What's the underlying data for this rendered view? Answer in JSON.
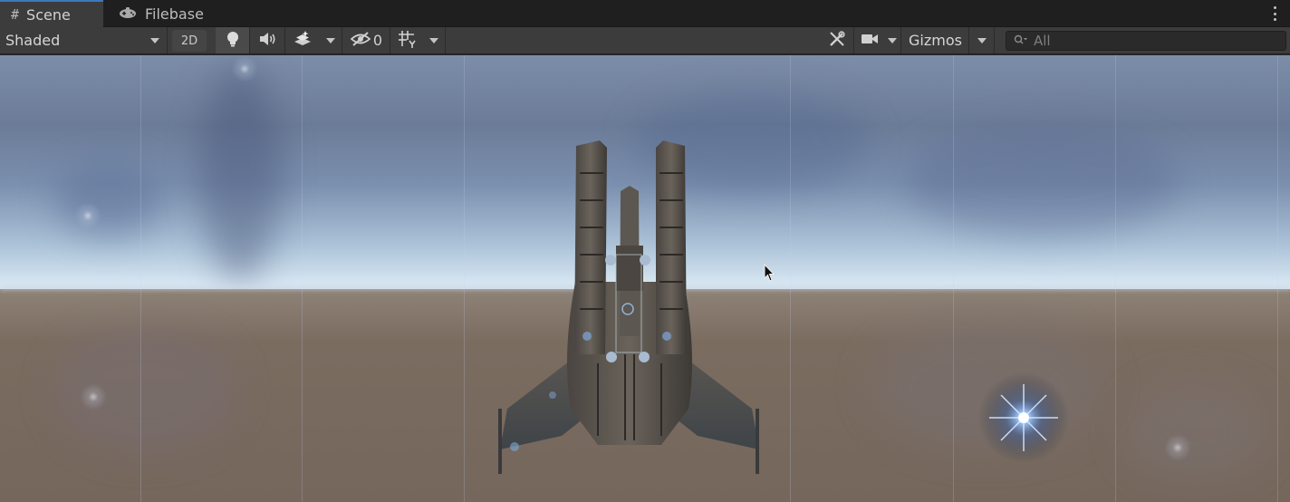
{
  "tabs": [
    {
      "label": "Scene",
      "icon": "grid-hash-icon",
      "active": true
    },
    {
      "label": "Filebase",
      "icon": "game-controller-icon",
      "active": false
    }
  ],
  "toolbar": {
    "shading_mode": "Shaded",
    "toggle_2d": "2D",
    "hidden_count": "0",
    "gizmos_label": "Gizmos",
    "search_placeholder": "All"
  },
  "colors": {
    "accent": "#3a79bb",
    "panel": "#3c3c3c",
    "tab_bar": "#1f1f1f",
    "sky_top": "#6b7c98",
    "horizon": "#dcebf6",
    "ground": "#7b6c60"
  },
  "icons": [
    "grid-hash-icon",
    "game-controller-icon",
    "kebab-menu-icon",
    "lighting-bulb-icon",
    "audio-speaker-icon",
    "effects-layers-icon",
    "hidden-eye-icon",
    "grid-snap-icon",
    "tools-icon",
    "camera-icon",
    "search-icon",
    "mouse-cursor-icon",
    "light-flare-icon"
  ]
}
